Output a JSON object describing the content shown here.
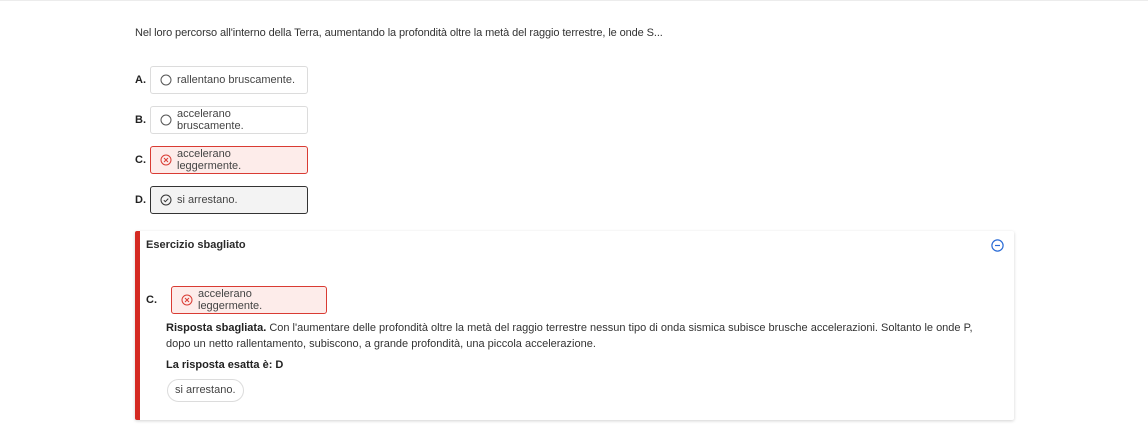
{
  "question": {
    "text": "Nel loro percorso all'interno della Terra, aumentando la profondità oltre la metà del raggio terrestre, le onde S..."
  },
  "options": [
    {
      "letter": "A.",
      "text": "rallentano bruscamente.",
      "state": "unselected",
      "icon": "radio-empty-icon"
    },
    {
      "letter": "B.",
      "text": "accelerano bruscamente.",
      "state": "unselected",
      "icon": "radio-empty-icon"
    },
    {
      "letter": "C.",
      "text": "accelerano leggermente.",
      "state": "wrong",
      "icon": "x-circle-icon"
    },
    {
      "letter": "D.",
      "text": "si arrestano.",
      "state": "correct",
      "icon": "check-circle-icon"
    }
  ],
  "feedback": {
    "title": "Esercizio sbagliato",
    "collapse_icon": "minus-circle-icon",
    "selected_letter": "C.",
    "selected_text": "accelerano leggermente.",
    "explanation_label": "Risposta sbagliata.",
    "explanation_text": " Con l'aumentare delle profondità oltre la metà del raggio terrestre nessun tipo di onda sismica subisce brusche accelerazioni. Soltanto le onde P, dopo un netto rallentamento, subiscono, a grande profondità, una piccola accelerazione.",
    "correct_label": "La risposta esatta è: D",
    "correct_text": "si arrestano."
  },
  "colors": {
    "wrong": "#d93b33",
    "wrong_bg": "#fdecea",
    "accent_border": "#d42a22",
    "link_blue": "#2b6cd6"
  }
}
